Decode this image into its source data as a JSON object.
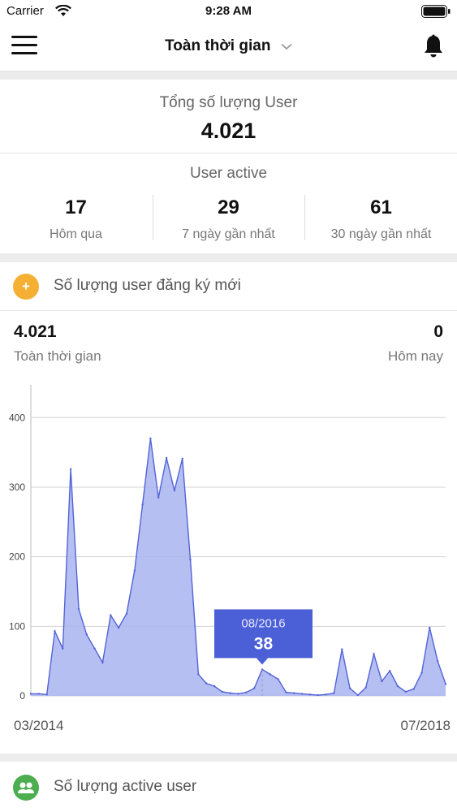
{
  "status_bar": {
    "carrier": "Carrier",
    "time": "9:28 AM"
  },
  "nav": {
    "title": "Toàn thời gian"
  },
  "totals": {
    "label": "Tổng số lượng User",
    "value": "4.021",
    "active_label": "User active",
    "stats": [
      {
        "value": "17",
        "label": "Hôm qua"
      },
      {
        "value": "29",
        "label": "7 ngày gần nhất"
      },
      {
        "value": "61",
        "label": "30 ngày gần nhất"
      }
    ]
  },
  "new_users": {
    "title": "Số lượng user đăng ký mới",
    "icon": "user-plus-icon",
    "left_value": "4.021",
    "left_label": "Toàn thời gian",
    "right_value": "0",
    "right_label": "Hôm nay"
  },
  "active_users": {
    "title": "Số lượng active user",
    "icon": "group-icon"
  },
  "colors": {
    "accent": "#4b5fd6",
    "area_fill": "#a9b4ef",
    "area_line": "#5263d8",
    "icon_orange": "#f5b033",
    "icon_green": "#4cae4f"
  },
  "chart_data": {
    "type": "area",
    "ylim": [
      0,
      440
    ],
    "y_ticks": [
      "0",
      "100",
      "200",
      "300",
      "400"
    ],
    "y_tick_values": [
      0,
      100,
      200,
      300,
      400
    ],
    "x_labels": [
      "03/2014",
      "07/2018"
    ],
    "grid": true,
    "series": [
      {
        "values": [
          3,
          3,
          2,
          93,
          68,
          326,
          125,
          88,
          68,
          48,
          116,
          98,
          118,
          180,
          275,
          370,
          285,
          342,
          295,
          341,
          196,
          31,
          18,
          14,
          6,
          4,
          3,
          5,
          11,
          38,
          31,
          24,
          5,
          4,
          3,
          2,
          1,
          2,
          4,
          67,
          11,
          1,
          12,
          60,
          21,
          36,
          14,
          6,
          10,
          33,
          98,
          50,
          17
        ]
      }
    ],
    "tooltip": {
      "label": "08/2016",
      "value": "38",
      "index": 29
    }
  }
}
